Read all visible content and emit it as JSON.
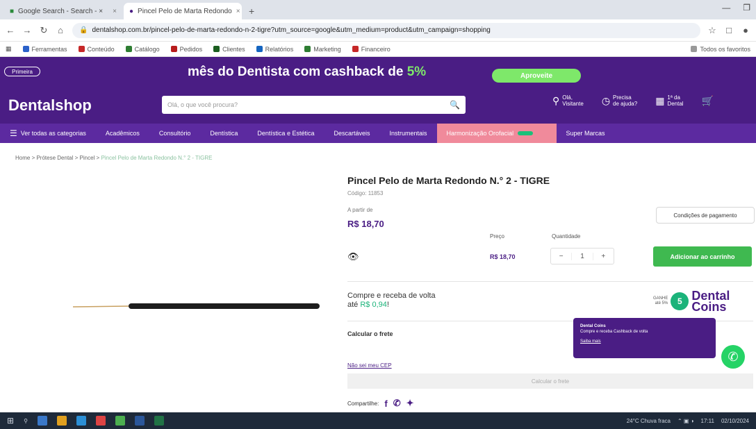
{
  "browser": {
    "tabs": [
      {
        "label": "Google Search - Search - ×",
        "active": false
      },
      {
        "label": "Pincel Pelo de Marta Redondo",
        "active": true
      }
    ],
    "address": {
      "host": "dentalshop.com.br",
      "url": "dentalshop.com.br/pincel-pelo-de-marta-redondo-n-2-tigre?utm_source=google&utm_medium=product&utm_campaign=shopping"
    },
    "bookmarks": [
      "Ferramentas",
      "Conteúdo",
      "Catálogo",
      "Pedidos",
      "Clientes",
      "Relatórios",
      "Marketing",
      "Financeiro",
      "Todos os favoritos"
    ]
  },
  "promo": {
    "pill": "Primeira",
    "text_before": "mês do Dentista com cashback de",
    "pct": "5%",
    "cta": "Aproveite",
    "accent": "#7ee86a",
    "bg": "#4a1d84"
  },
  "header": {
    "logo": "Dentalshop",
    "search_placeholder": "Olá, o que você procura?",
    "actions": [
      {
        "icon": "user-icon",
        "line1": "Olá,",
        "line2": "Visitante"
      },
      {
        "icon": "help-icon",
        "line1": "Precisa",
        "line2": "de ajuda?"
      },
      {
        "icon": "store-icon",
        "line1": "1ª da",
        "line2": "Dental"
      },
      {
        "icon": "cart-icon",
        "line1": "",
        "line2": ""
      }
    ]
  },
  "categories": [
    "Ver todas as categorias",
    "Acadêmicos",
    "Consultório",
    "Dentística",
    "Dentística e Estética",
    "Descartáveis",
    "Instrumentais",
    "Harmonização Orofacial",
    "Super Marcas"
  ],
  "breadcrumb": [
    "Home",
    "Prótese Dental",
    "Pincel",
    "Pincel Pelo de Marta Redondo N.° 2 - TIGRE"
  ],
  "product": {
    "title": "Pincel Pelo de Marta Redondo N.° 2 - TIGRE",
    "code": "Código: 11853",
    "from_label": "A partir de",
    "price": "R$ 18,70",
    "pay_conditions": "Condições de pagamento",
    "col_price": "Preço",
    "col_qty": "Quantidade",
    "row_price": "R$ 18,70",
    "qty": "1",
    "add_cart": "Adicionar ao carrinho",
    "cashback_line1": "Compre e receba de volta",
    "cashback_line2_a": "até",
    "cashback_amount": "R$ 0,94",
    "coins_small1": "GANHE",
    "coins_small2": "até 5%",
    "coins_badge": "5",
    "coins_word1": "Dental",
    "coins_word2": "Coins",
    "frete": "Calcular o frete",
    "cep_link": "Não sei meu CEP",
    "calc_btn": "Calcular o frete",
    "share_label": "Compartilhe:"
  },
  "popup": {
    "title": "Dental Coins",
    "body": "Compre e receba Cashback de volta",
    "link": "Saiba mais"
  },
  "taskbar": {
    "weather": "24°C Chuva fraca",
    "time": "17:11",
    "date": "02/10/2024"
  }
}
